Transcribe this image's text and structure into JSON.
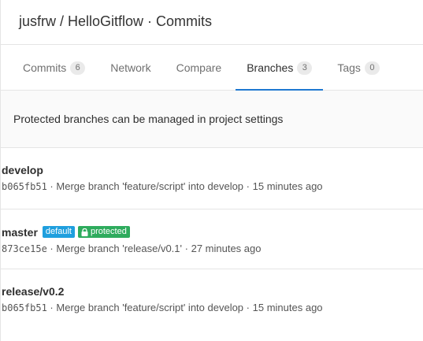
{
  "header": {
    "title": "jusfrw / HelloGitflow · Commits"
  },
  "tabs": [
    {
      "label": "Commits",
      "count": "6"
    },
    {
      "label": "Network",
      "count": null
    },
    {
      "label": "Compare",
      "count": null
    },
    {
      "label": "Branches",
      "count": "3",
      "active": true
    },
    {
      "label": "Tags",
      "count": "0"
    }
  ],
  "info": {
    "text": "Protected branches can be managed in project settings"
  },
  "branches": [
    {
      "name": "develop",
      "sha": "b065fb51",
      "message": "Merge branch 'feature/script' into develop",
      "time": "15 minutes ago"
    },
    {
      "name": "master",
      "badges": {
        "default": "default",
        "protected": "protected"
      },
      "sha": "873ce15e",
      "message": "Merge branch 'release/v0.1'",
      "time": "27 minutes ago"
    },
    {
      "name": "release/v0.2",
      "sha": "b065fb51",
      "message": "Merge branch 'feature/script' into develop",
      "time": "15 minutes ago"
    }
  ],
  "separator": "·",
  "colors": {
    "accent": "#1f78d1",
    "default_badge": "#1f9fde",
    "protected_badge": "#2eab5d"
  },
  "icons": {
    "protected": "lock-icon"
  }
}
